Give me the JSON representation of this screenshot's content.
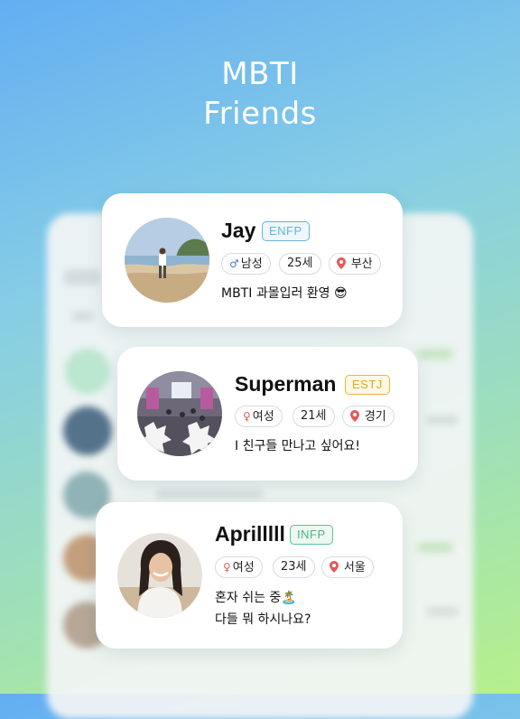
{
  "header": {
    "line1": "MBTI",
    "line2": "Friends"
  },
  "cards": [
    {
      "name": "Jay",
      "mbti": "ENFP",
      "mbti_color": "#69b3d9",
      "gender_icon": "male-icon",
      "gender_symbol": "♂",
      "gender": "남성",
      "age": "25세",
      "location": "부산",
      "message_line1": "MBTI 과몰입러 환영 😎",
      "message_line2": ""
    },
    {
      "name": "Superman",
      "mbti": "ESTJ",
      "mbti_color": "#e3b93a",
      "gender_icon": "female-icon",
      "gender_symbol": "♀",
      "gender": "여성",
      "age": "21세",
      "location": "경기",
      "message_line1": "I 친구들 만나고 싶어요!",
      "message_line2": ""
    },
    {
      "name": "Aprilllll",
      "mbti": "INFP",
      "mbti_color": "#5cc28f",
      "gender_icon": "female-icon",
      "gender_symbol": "♀",
      "gender": "여성",
      "age": "23세",
      "location": "서울",
      "message_line1": "혼자 쉬는 중🏝️",
      "message_line2": "다들 뭐 하시나요?"
    }
  ],
  "colors": {
    "male": "#4a78c8",
    "female": "#e4595a",
    "pin": "#e4595a"
  }
}
